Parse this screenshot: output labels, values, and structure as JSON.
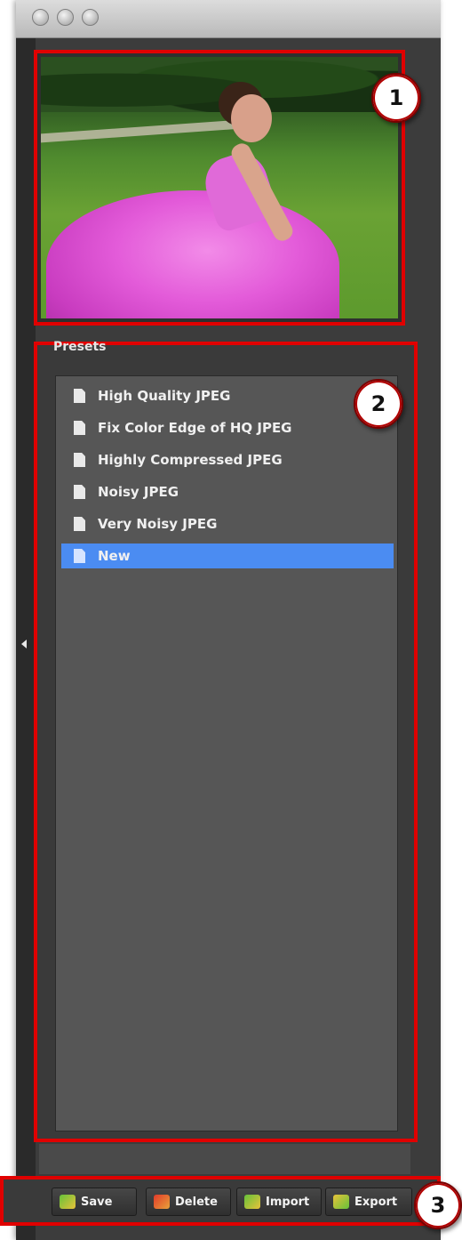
{
  "window": {
    "controls": [
      "close",
      "minimize",
      "zoom"
    ]
  },
  "preview": {
    "callout": "1",
    "image_desc": "girl in pink dress"
  },
  "presets": {
    "title": "Presets",
    "callout": "2",
    "items": [
      {
        "label": "High Quality JPEG",
        "icon": "document-icon",
        "selected": false
      },
      {
        "label": "Fix Color Edge of HQ JPEG",
        "icon": "document-icon",
        "selected": false
      },
      {
        "label": "Highly Compressed JPEG",
        "icon": "document-icon",
        "selected": false
      },
      {
        "label": "Noisy JPEG",
        "icon": "document-icon",
        "selected": false
      },
      {
        "label": "Very Noisy JPEG",
        "icon": "document-icon",
        "selected": false
      },
      {
        "label": "New",
        "icon": "document-icon",
        "selected": true
      }
    ]
  },
  "toolbar": {
    "callout": "3",
    "save_label": "Save",
    "delete_label": "Delete",
    "import_label": "Import",
    "export_label": "Export"
  },
  "colors": {
    "highlight": "#e00000",
    "selection": "#4b8cf2",
    "panel": "#3a3a3a",
    "list_bg": "#565656"
  }
}
